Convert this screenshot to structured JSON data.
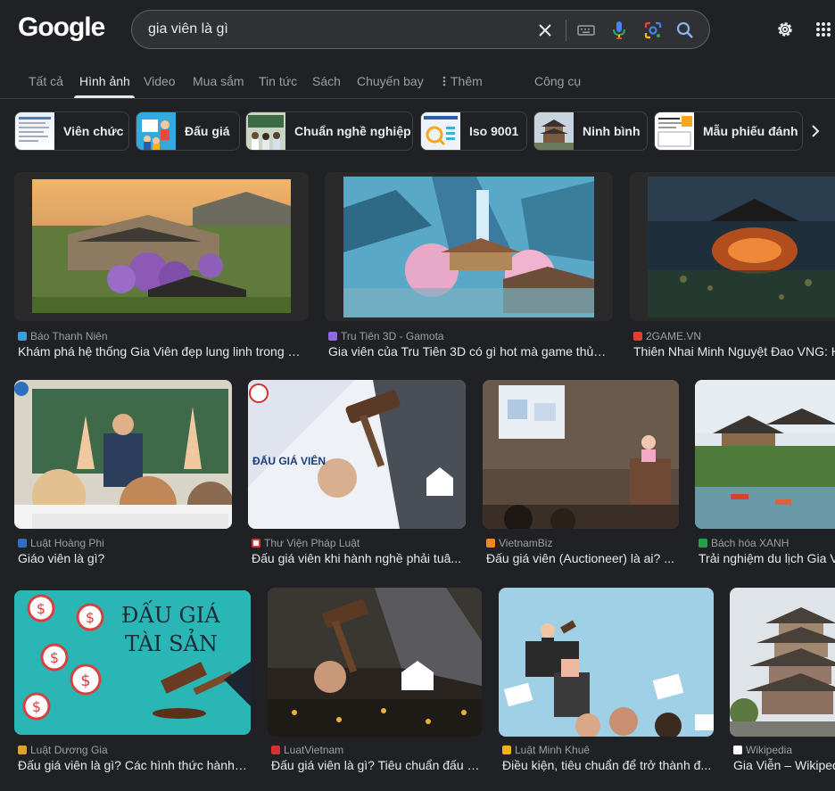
{
  "header": {
    "logo": "Google",
    "search_value": "gia viên là gì"
  },
  "tabs": [
    {
      "label": "Tất cả"
    },
    {
      "label": "Hình ảnh"
    },
    {
      "label": "Video"
    },
    {
      "label": "Mua sắm"
    },
    {
      "label": "Tin tức"
    },
    {
      "label": "Sách"
    },
    {
      "label": "Chuyến bay"
    },
    {
      "label": "Thêm"
    },
    {
      "label": "Công cụ"
    }
  ],
  "chips": [
    {
      "label": "Viên chức"
    },
    {
      "label": "Đấu giá"
    },
    {
      "label": "Chuẩn nghề nghiệp"
    },
    {
      "label": "Iso 9001"
    },
    {
      "label": "Ninh bình"
    },
    {
      "label": "Mẫu phiếu đánh"
    }
  ],
  "results": [
    {
      "source": "Báo Thanh Niên",
      "title": "Khám phá hệ thống Gia Viên đẹp lung linh trong N..."
    },
    {
      "source": "Tru Tiên 3D - Gamota",
      "title": "Gia viên của Tru Tiên 3D có gì hot mà game thủ h..."
    },
    {
      "source": "2GAME.VN",
      "title": "Thiên Nhai Minh Nguyệt Đao VNG: Hệ"
    },
    {
      "source": "Luật Hoàng Phi",
      "title": "Giáo viên là gì?"
    },
    {
      "source": "Thư Viện Pháp Luật",
      "title": "Đấu giá viên khi hành nghề phải tuâ..."
    },
    {
      "source": "VietnamBiz",
      "title": "Đấu giá viên (Auctioneer) là ai? ..."
    },
    {
      "source": "Bách hóa XANH",
      "title": "Trải nghiệm du lịch Gia Viễ"
    },
    {
      "source": "Luật Dương Gia",
      "title": "Đấu giá viên là gì? Các hình thức hành ..."
    },
    {
      "source": "LuatVietnam",
      "title": "Đấu giá viên là gì? Tiêu chuẩn đấu g..."
    },
    {
      "source": "Luật Minh Khuê",
      "title": "Điều kiện, tiêu chuẩn để trở thành đ..."
    },
    {
      "source": "Wikipedia",
      "title": "Gia Viễn – Wikiped"
    }
  ],
  "image_text": {
    "auction_banner_line1": "ĐẤU GIÁ",
    "auction_banner_line2": "TÀI SẢN",
    "dau_gia_vien": "ĐẤU GIÁ VIÊN"
  }
}
